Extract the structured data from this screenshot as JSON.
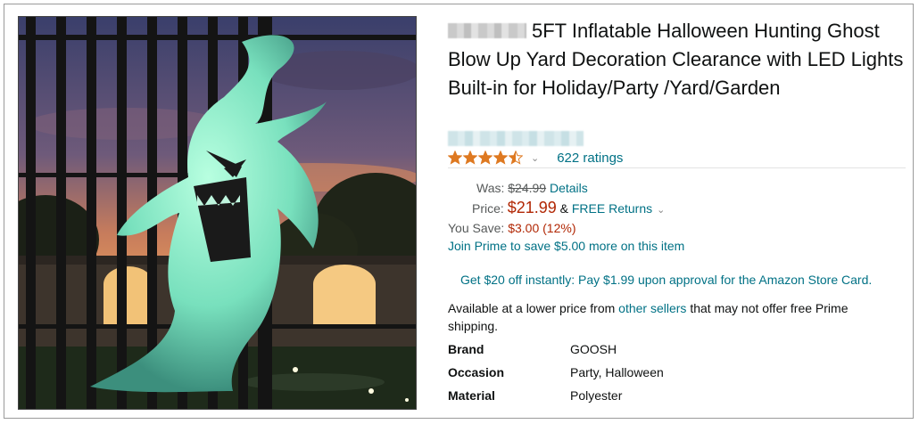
{
  "product": {
    "title": "5FT Inflatable Halloween Hunting Ghost Blow Up Yard Decoration Clearance with LED Lights Built-in for Holiday/Party /Yard/Garden",
    "image_alt": "Inflatable ghost decoration on a gate at dusk"
  },
  "rating": {
    "stars": 4.5,
    "ratings_text": "622 ratings",
    "star_color": "#de7921"
  },
  "pricing": {
    "was_label": "Was:",
    "was_value": "$24.99",
    "details_link": "Details",
    "price_label": "Price:",
    "price_value": "$21.99",
    "ampersand": "&",
    "free_returns": "FREE Returns",
    "you_save_label": "You Save:",
    "you_save_value": "$3.00 (12%)",
    "prime_link": "Join Prime to save $5.00 more on this item"
  },
  "store_card": "Get $20 off instantly: Pay $1.99 upon approval for the Amazon Store Card.",
  "availability": {
    "prefix": "Available at a lower price from ",
    "link": "other sellers",
    "suffix": " that may not offer free Prime shipping."
  },
  "specs": [
    {
      "key": "Brand",
      "value": "GOOSH"
    },
    {
      "key": "Occasion",
      "value": "Party, Halloween"
    },
    {
      "key": "Material",
      "value": "Polyester"
    }
  ],
  "colors": {
    "link": "#007185",
    "price": "#b12704",
    "text": "#0f1111"
  }
}
